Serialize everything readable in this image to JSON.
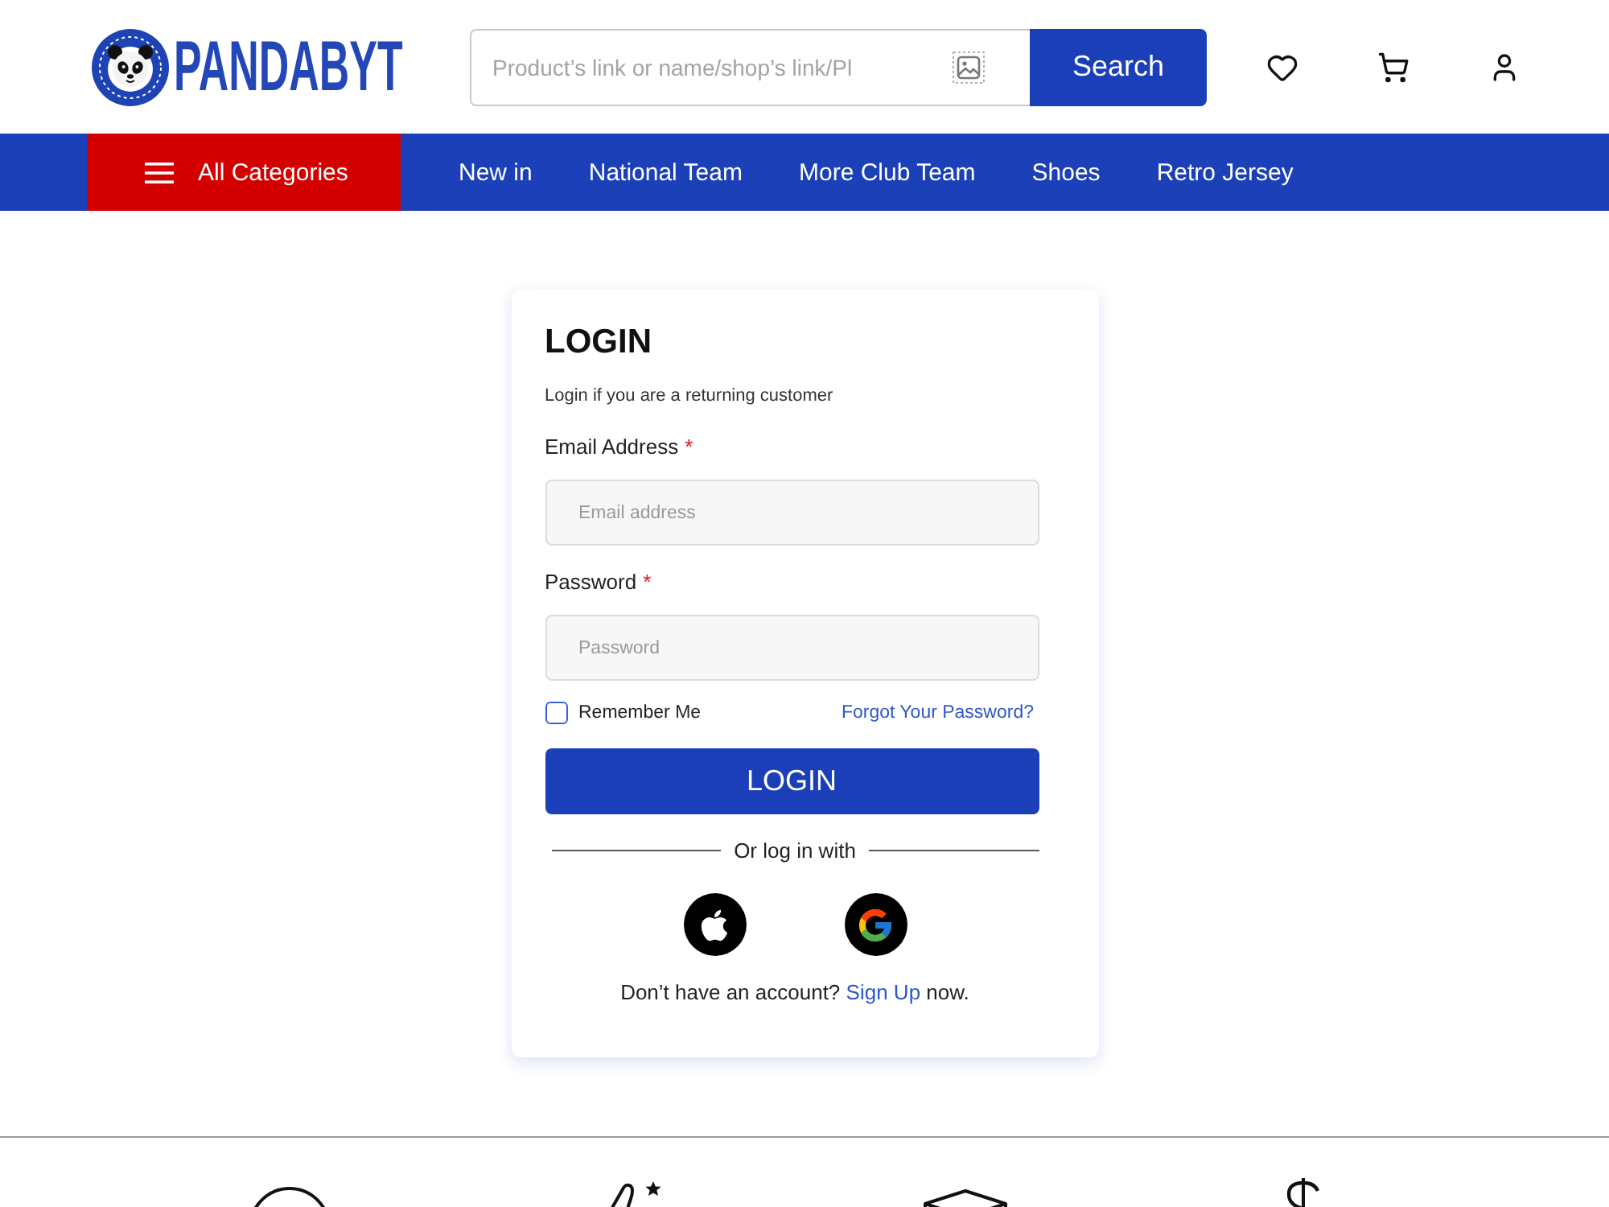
{
  "header": {
    "logo_text": "PANDABYT",
    "search": {
      "placeholder": "Product’s link or name/shop’s link/Pl",
      "button": "Search"
    }
  },
  "nav": {
    "categories_button": "All Categories",
    "links": [
      "New in",
      "National Team",
      "More Club Team",
      "Shoes",
      "Retro Jersey"
    ]
  },
  "login": {
    "title": "LOGIN",
    "subtitle": "Login if you are a returning customer",
    "fields": [
      {
        "label": "Email Address",
        "required_mark": "*",
        "placeholder": "Email address"
      },
      {
        "label": "Password",
        "required_mark": "*",
        "placeholder": "Password"
      }
    ],
    "remember": {
      "label": "Remember Me",
      "checked": false
    },
    "forgot_link": "Forgot Your Password?",
    "submit": "LOGIN",
    "divider_text": "Or log in with",
    "signup": {
      "prompt": "Don’t have an account?",
      "link": "Sign Up",
      "suffix": "now."
    }
  }
}
